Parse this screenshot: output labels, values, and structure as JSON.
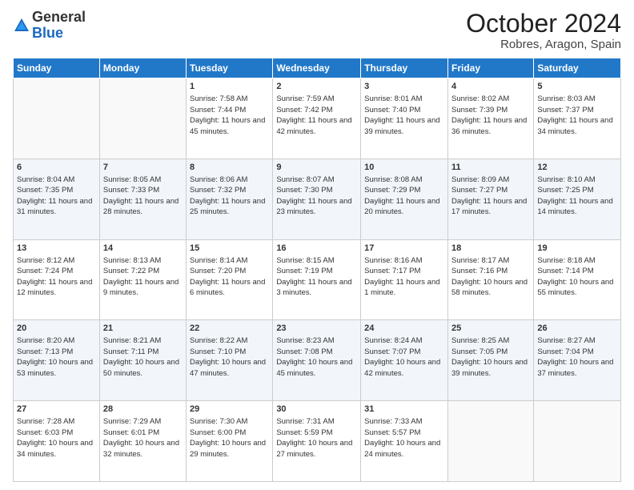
{
  "logo": {
    "general": "General",
    "blue": "Blue"
  },
  "title": {
    "month": "October 2024",
    "location": "Robres, Aragon, Spain"
  },
  "weekdays": [
    "Sunday",
    "Monday",
    "Tuesday",
    "Wednesday",
    "Thursday",
    "Friday",
    "Saturday"
  ],
  "weeks": [
    [
      {
        "day": "",
        "info": ""
      },
      {
        "day": "",
        "info": ""
      },
      {
        "day": "1",
        "info": "Sunrise: 7:58 AM\nSunset: 7:44 PM\nDaylight: 11 hours and 45 minutes."
      },
      {
        "day": "2",
        "info": "Sunrise: 7:59 AM\nSunset: 7:42 PM\nDaylight: 11 hours and 42 minutes."
      },
      {
        "day": "3",
        "info": "Sunrise: 8:01 AM\nSunset: 7:40 PM\nDaylight: 11 hours and 39 minutes."
      },
      {
        "day": "4",
        "info": "Sunrise: 8:02 AM\nSunset: 7:39 PM\nDaylight: 11 hours and 36 minutes."
      },
      {
        "day": "5",
        "info": "Sunrise: 8:03 AM\nSunset: 7:37 PM\nDaylight: 11 hours and 34 minutes."
      }
    ],
    [
      {
        "day": "6",
        "info": "Sunrise: 8:04 AM\nSunset: 7:35 PM\nDaylight: 11 hours and 31 minutes."
      },
      {
        "day": "7",
        "info": "Sunrise: 8:05 AM\nSunset: 7:33 PM\nDaylight: 11 hours and 28 minutes."
      },
      {
        "day": "8",
        "info": "Sunrise: 8:06 AM\nSunset: 7:32 PM\nDaylight: 11 hours and 25 minutes."
      },
      {
        "day": "9",
        "info": "Sunrise: 8:07 AM\nSunset: 7:30 PM\nDaylight: 11 hours and 23 minutes."
      },
      {
        "day": "10",
        "info": "Sunrise: 8:08 AM\nSunset: 7:29 PM\nDaylight: 11 hours and 20 minutes."
      },
      {
        "day": "11",
        "info": "Sunrise: 8:09 AM\nSunset: 7:27 PM\nDaylight: 11 hours and 17 minutes."
      },
      {
        "day": "12",
        "info": "Sunrise: 8:10 AM\nSunset: 7:25 PM\nDaylight: 11 hours and 14 minutes."
      }
    ],
    [
      {
        "day": "13",
        "info": "Sunrise: 8:12 AM\nSunset: 7:24 PM\nDaylight: 11 hours and 12 minutes."
      },
      {
        "day": "14",
        "info": "Sunrise: 8:13 AM\nSunset: 7:22 PM\nDaylight: 11 hours and 9 minutes."
      },
      {
        "day": "15",
        "info": "Sunrise: 8:14 AM\nSunset: 7:20 PM\nDaylight: 11 hours and 6 minutes."
      },
      {
        "day": "16",
        "info": "Sunrise: 8:15 AM\nSunset: 7:19 PM\nDaylight: 11 hours and 3 minutes."
      },
      {
        "day": "17",
        "info": "Sunrise: 8:16 AM\nSunset: 7:17 PM\nDaylight: 11 hours and 1 minute."
      },
      {
        "day": "18",
        "info": "Sunrise: 8:17 AM\nSunset: 7:16 PM\nDaylight: 10 hours and 58 minutes."
      },
      {
        "day": "19",
        "info": "Sunrise: 8:18 AM\nSunset: 7:14 PM\nDaylight: 10 hours and 55 minutes."
      }
    ],
    [
      {
        "day": "20",
        "info": "Sunrise: 8:20 AM\nSunset: 7:13 PM\nDaylight: 10 hours and 53 minutes."
      },
      {
        "day": "21",
        "info": "Sunrise: 8:21 AM\nSunset: 7:11 PM\nDaylight: 10 hours and 50 minutes."
      },
      {
        "day": "22",
        "info": "Sunrise: 8:22 AM\nSunset: 7:10 PM\nDaylight: 10 hours and 47 minutes."
      },
      {
        "day": "23",
        "info": "Sunrise: 8:23 AM\nSunset: 7:08 PM\nDaylight: 10 hours and 45 minutes."
      },
      {
        "day": "24",
        "info": "Sunrise: 8:24 AM\nSunset: 7:07 PM\nDaylight: 10 hours and 42 minutes."
      },
      {
        "day": "25",
        "info": "Sunrise: 8:25 AM\nSunset: 7:05 PM\nDaylight: 10 hours and 39 minutes."
      },
      {
        "day": "26",
        "info": "Sunrise: 8:27 AM\nSunset: 7:04 PM\nDaylight: 10 hours and 37 minutes."
      }
    ],
    [
      {
        "day": "27",
        "info": "Sunrise: 7:28 AM\nSunset: 6:03 PM\nDaylight: 10 hours and 34 minutes."
      },
      {
        "day": "28",
        "info": "Sunrise: 7:29 AM\nSunset: 6:01 PM\nDaylight: 10 hours and 32 minutes."
      },
      {
        "day": "29",
        "info": "Sunrise: 7:30 AM\nSunset: 6:00 PM\nDaylight: 10 hours and 29 minutes."
      },
      {
        "day": "30",
        "info": "Sunrise: 7:31 AM\nSunset: 5:59 PM\nDaylight: 10 hours and 27 minutes."
      },
      {
        "day": "31",
        "info": "Sunrise: 7:33 AM\nSunset: 5:57 PM\nDaylight: 10 hours and 24 minutes."
      },
      {
        "day": "",
        "info": ""
      },
      {
        "day": "",
        "info": ""
      }
    ]
  ]
}
